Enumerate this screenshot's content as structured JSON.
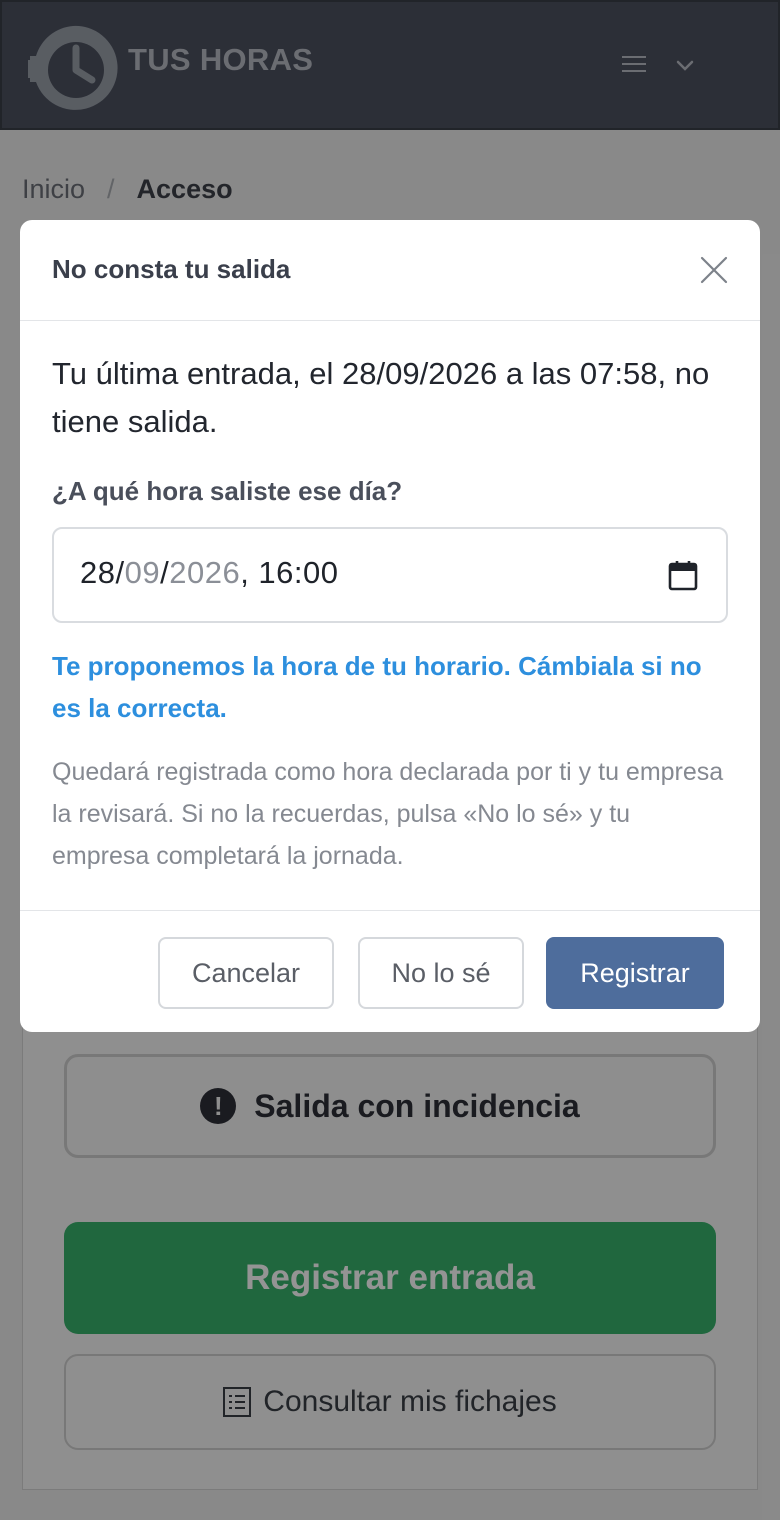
{
  "app": {
    "brand": "TUS HORAS"
  },
  "breadcrumb": {
    "home": "Inicio",
    "separator": "/",
    "current": "Acceso"
  },
  "modal": {
    "title": "No consta tu salida",
    "message": "Tu última entrada, el 28/09/2026 a las 07:58, no tiene salida.",
    "question": "¿A qué hora saliste ese día?",
    "datetime": {
      "day": "28",
      "month": "09",
      "year": "2026",
      "time": "16:00"
    },
    "proposal": "Te proponemos la hora de tu horario. Cámbiala si no es la correcta.",
    "note": "Quedará registrada como hora declarada por ti y tu empresa la revisará. Si no la recuerdas, pulsa «No lo sé» y tu empresa completará la jornada.",
    "buttons": {
      "cancel": "Cancelar",
      "unknown": "No lo sé",
      "submit": "Registrar"
    }
  },
  "page": {
    "incidencia_label": "Salida con incidencia",
    "entrada_label": "Registrar entrada",
    "fichajes_label": "Consultar mis fichajes"
  },
  "icons": {
    "logo": "gear-clock-logo",
    "menu": "hamburger-icon",
    "dropdown": "chevron-down-icon",
    "close": "close-icon",
    "calendar": "calendar-icon",
    "warning": "exclamation-circle-icon",
    "list": "list-icon"
  },
  "colors": {
    "header": "#4d5260",
    "primary": "#4e6d9c",
    "accent_blue": "#2d8fde",
    "success": "#38b26c"
  }
}
